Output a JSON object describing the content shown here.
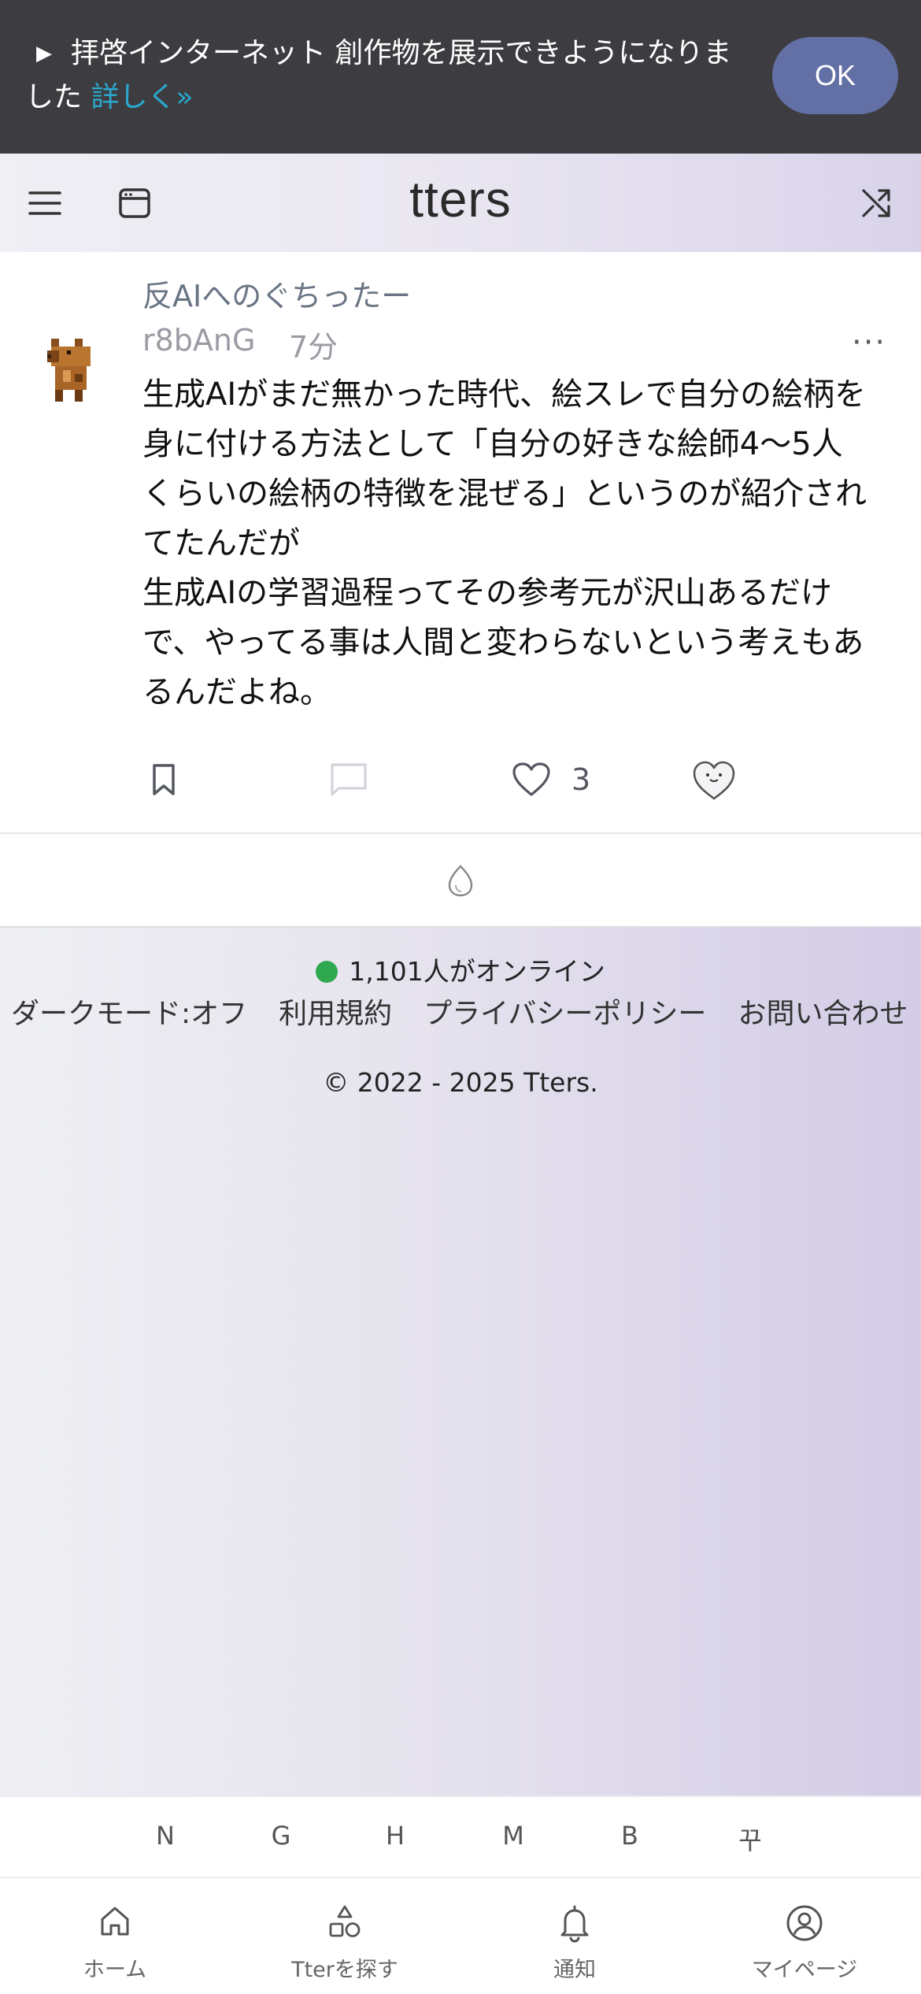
{
  "banner": {
    "text": "拝啓インターネット 創作物を展示できようになりました",
    "link": "詳しく»",
    "ok_label": "OK"
  },
  "header": {
    "logo": "tters",
    "menu_icon": "hamburger-menu-icon",
    "window_icon": "window-icon",
    "shuffle_icon": "shuffle-icon"
  },
  "post": {
    "community": "反AIへのぐちったー",
    "author": "r8bAnG",
    "time": "7分",
    "more": "···",
    "body": "生成AIがまだ無かった時代、絵スレで自分の絵柄を身に付ける方法として「自分の好きな絵師4〜5人くらいの絵柄の特徴を混ぜる」というのが紹介されてたんだが\n生成AIの学習過程ってその参考元が沢山あるだけで、やってる事は人間と変わらないという考えもあるんだよね。",
    "like_count": "3",
    "icons": {
      "bookmark": "bookmark-icon",
      "comment": "comment-icon",
      "like": "heart-icon",
      "reaction": "heart-face-icon"
    }
  },
  "loader": {
    "icon": "egg-icon"
  },
  "footer": {
    "online": "1,101人がオンライン",
    "links": [
      "ダークモード:オフ",
      "利用規約",
      "プライバシーポリシー",
      "お問い合わせ"
    ],
    "copyright": "© 2022 - 2025 Tters."
  },
  "shortcuts": [
    "N",
    "G",
    "H",
    "M",
    "B",
    "꾸"
  ],
  "nav": [
    {
      "label": "ホーム",
      "icon": "home-icon"
    },
    {
      "label": "Tterを探す",
      "icon": "shapes-icon"
    },
    {
      "label": "通知",
      "icon": "bell-icon"
    },
    {
      "label": "マイページ",
      "icon": "user-circle-icon"
    }
  ],
  "colors": {
    "banner_bg": "#3d3d41",
    "ok_button": "#6370a6",
    "link": "#29a9cf",
    "online_dot": "#2fa84f"
  }
}
